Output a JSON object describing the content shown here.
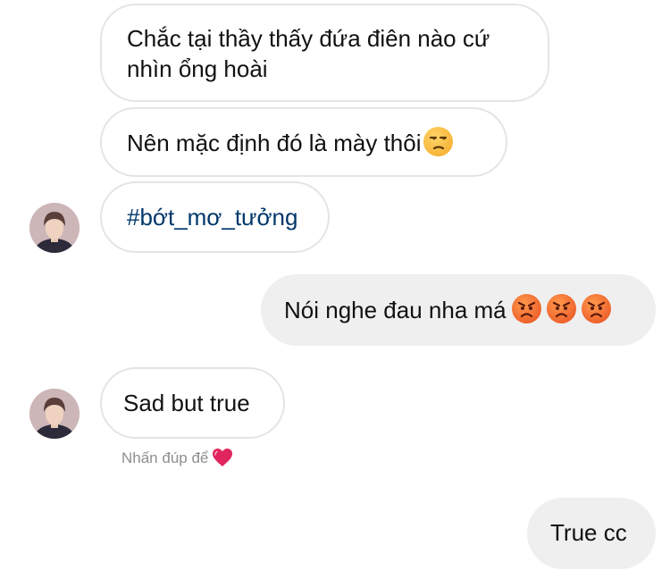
{
  "messages": [
    {
      "from": "them",
      "text": "Chắc tại thầy thấy đứa điên nào cứ nhìn ổng hoài",
      "line1": "Chắc tại thầy thấy đứa điên nào cứ",
      "line2": "nhìn ổng hoài"
    },
    {
      "from": "them",
      "text": "Nên mặc định đó là mày thôi",
      "emoji": "unamused-face"
    },
    {
      "from": "them",
      "text": "#bớt_mơ_tưởng",
      "is_hashtag": true
    },
    {
      "from": "me",
      "text": "Nói nghe đau nha má",
      "emoji": [
        "pouting-face",
        "pouting-face",
        "pouting-face"
      ]
    },
    {
      "from": "them",
      "text": "Sad but true",
      "hint": "Nhấn đúp để"
    },
    {
      "from": "me",
      "text": "True cc"
    }
  ],
  "colors": {
    "incoming_bubble_border": "#e4e4e4",
    "outgoing_bubble_bg": "#efefef",
    "hashtag": "#00376b",
    "hint_text": "#8e8e8e",
    "heart": "#e0245e"
  },
  "icons": {
    "avatar": "contact-avatar",
    "hint_heart": "heart-icon"
  }
}
